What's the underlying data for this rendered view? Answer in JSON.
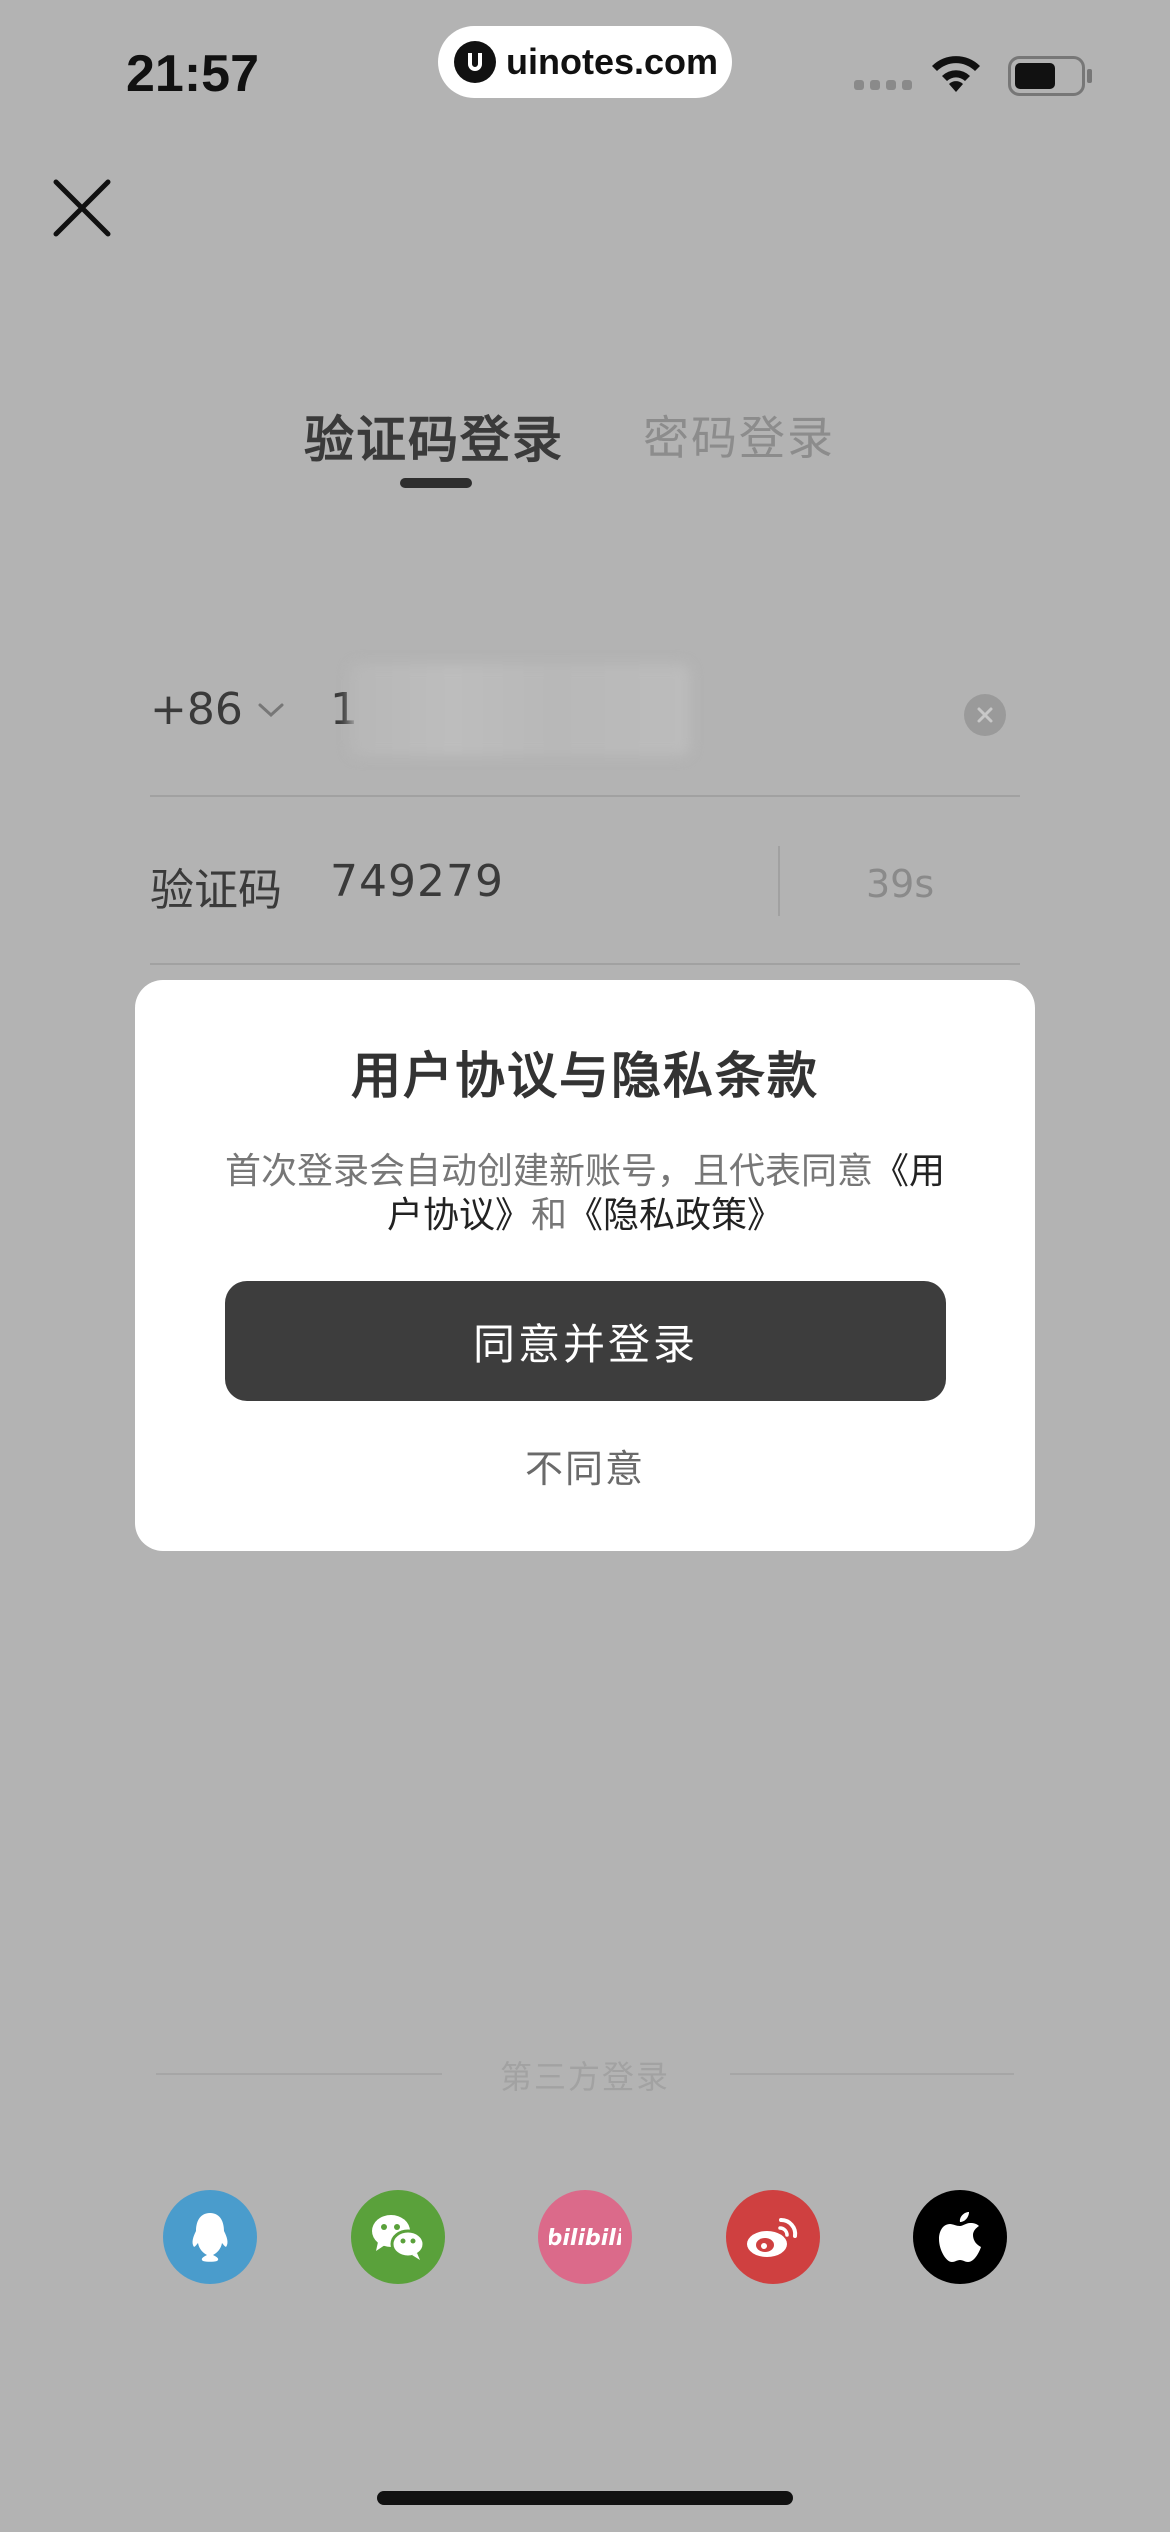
{
  "status_bar": {
    "time": "21:57",
    "url": "uinotes.com"
  },
  "tabs": [
    {
      "label": "验证码登录",
      "active": true
    },
    {
      "label": "密码登录",
      "active": false
    }
  ],
  "phone_field": {
    "country_code": "+86",
    "value_visible": "1"
  },
  "code_field": {
    "label": "验证码",
    "value": "749279",
    "countdown": "39s"
  },
  "dialog": {
    "title": "用户协议与隐私条款",
    "body_prefix": "首次登录会自动创建新账号，且代表同意",
    "link_user_agreement": "《用户协议》",
    "body_and": "和",
    "link_privacy_policy": "《隐私政策》",
    "agree_label": "同意并登录",
    "disagree_label": "不同意"
  },
  "third_party": {
    "label": "第三方登录",
    "providers": [
      {
        "name": "qq-icon",
        "color": "#4a9ccc"
      },
      {
        "name": "wechat-icon",
        "color": "#5aa13b"
      },
      {
        "name": "bilibili-icon",
        "color": "#db6a8a"
      },
      {
        "name": "weibo-icon",
        "color": "#cf4040"
      },
      {
        "name": "apple-icon",
        "color": "#000000"
      }
    ]
  },
  "colors": {
    "overlay_background": "#b3b3b3",
    "primary_button": "#3d3d3d"
  }
}
